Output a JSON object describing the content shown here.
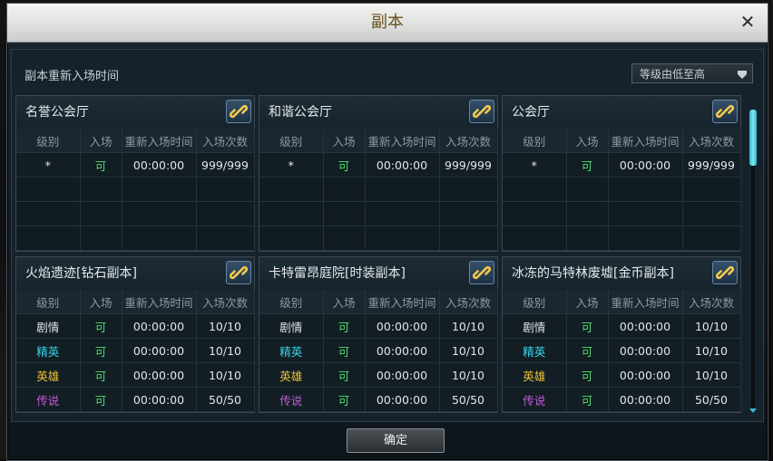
{
  "window": {
    "title": "副本",
    "close_label": "✕"
  },
  "section_title": "副本重新入场时间",
  "sort": {
    "selected": "等级由低至高"
  },
  "headers": [
    "级别",
    "入场",
    "重新入场时间",
    "入场次数"
  ],
  "panels": [
    {
      "name": "名誉公会厅",
      "rows": [
        {
          "level": "*",
          "entry": "可",
          "time": "00:00:00",
          "count": "999/999"
        }
      ]
    },
    {
      "name": "和谐公会厅",
      "rows": [
        {
          "level": "*",
          "entry": "可",
          "time": "00:00:00",
          "count": "999/999"
        }
      ]
    },
    {
      "name": "公会厅",
      "rows": [
        {
          "level": "*",
          "entry": "可",
          "time": "00:00:00",
          "count": "999/999"
        }
      ]
    },
    {
      "name": "火焰遗迹[钻石副本]",
      "rows": [
        {
          "level": "剧情",
          "entry": "可",
          "time": "00:00:00",
          "count": "10/10"
        },
        {
          "level": "精英",
          "entry": "可",
          "time": "00:00:00",
          "count": "10/10"
        },
        {
          "level": "英雄",
          "entry": "可",
          "time": "00:00:00",
          "count": "10/10"
        },
        {
          "level": "传说",
          "entry": "可",
          "time": "00:00:00",
          "count": "50/50"
        }
      ]
    },
    {
      "name": "卡特雷昂庭院[时装副本]",
      "rows": [
        {
          "level": "剧情",
          "entry": "可",
          "time": "00:00:00",
          "count": "10/10"
        },
        {
          "level": "精英",
          "entry": "可",
          "time": "00:00:00",
          "count": "10/10"
        },
        {
          "level": "英雄",
          "entry": "可",
          "time": "00:00:00",
          "count": "10/10"
        },
        {
          "level": "传说",
          "entry": "可",
          "time": "00:00:00",
          "count": "50/50"
        }
      ]
    },
    {
      "name": "冰冻的马特林废墟[金币副本]",
      "rows": [
        {
          "level": "剧情",
          "entry": "可",
          "time": "00:00:00",
          "count": "10/10"
        },
        {
          "level": "精英",
          "entry": "可",
          "time": "00:00:00",
          "count": "10/10"
        },
        {
          "level": "英雄",
          "entry": "可",
          "time": "00:00:00",
          "count": "10/10"
        },
        {
          "level": "传说",
          "entry": "可",
          "time": "00:00:00",
          "count": "50/50"
        }
      ]
    }
  ],
  "colors": {
    "entry_available": "#4fe06a",
    "level_normal": "#e2e6e9",
    "level_elite": "#38d6e8",
    "level_hero": "#e8c23a",
    "level_legend": "#c25bd8"
  },
  "icons": {
    "panel_link": "link-chain-icon",
    "close": "close-icon",
    "dropdown": "chevron-down-icon"
  },
  "ok_label": "确定"
}
